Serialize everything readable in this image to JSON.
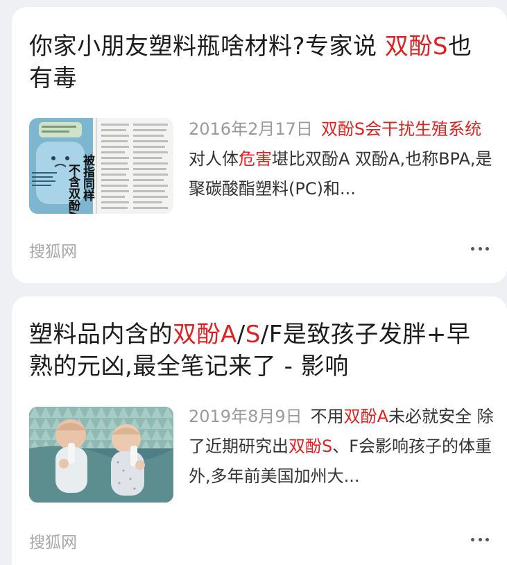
{
  "results": [
    {
      "title_parts": [
        {
          "text": "你家小朋友塑料瓶啥材料?专家说 ",
          "hl": false
        },
        {
          "text": "双酚S",
          "hl": true
        },
        {
          "text": "也有毒",
          "hl": false
        }
      ],
      "thumb_alt": "newspaper clipping",
      "thumb_text": [
        "被指同样",
        "不含双酚A"
      ],
      "date": "2016年2月17日",
      "snippet_parts": [
        {
          "text": "双酚S会干扰生殖系统",
          "hl": true
        },
        {
          "text": " 对人体",
          "hl": false
        },
        {
          "text": "危害",
          "hl": true
        },
        {
          "text": "堪比双酚A 双酚A,也称BPA,是聚碳酸酯塑料(PC)和...",
          "hl": false
        }
      ],
      "source": "搜狐网",
      "more_icon": "ellipsis-icon"
    },
    {
      "title_parts": [
        {
          "text": "塑料品内含的",
          "hl": false
        },
        {
          "text": "双酚A",
          "hl": true
        },
        {
          "text": "/",
          "hl": false
        },
        {
          "text": "S",
          "hl": true
        },
        {
          "text": "/F是致孩子发胖+早熟的元凶,最全笔记来了 - 影响",
          "hl": false
        }
      ],
      "thumb_alt": "two babies drinking bottles",
      "date": "2019年8月9日",
      "snippet_parts": [
        {
          "text": "不用",
          "hl": false
        },
        {
          "text": "双酚A",
          "hl": true
        },
        {
          "text": "未必就安全 除了近期研究出",
          "hl": false
        },
        {
          "text": "双酚S",
          "hl": true
        },
        {
          "text": "、F会影响孩子的体重外,多年前美国加州大...",
          "hl": false
        }
      ],
      "source": "搜狐网",
      "more_icon": "ellipsis-icon"
    }
  ],
  "colors": {
    "highlight": "#e02020",
    "text": "#1c1c1c",
    "meta": "#9a9a9a",
    "background": "#eef0f4"
  }
}
